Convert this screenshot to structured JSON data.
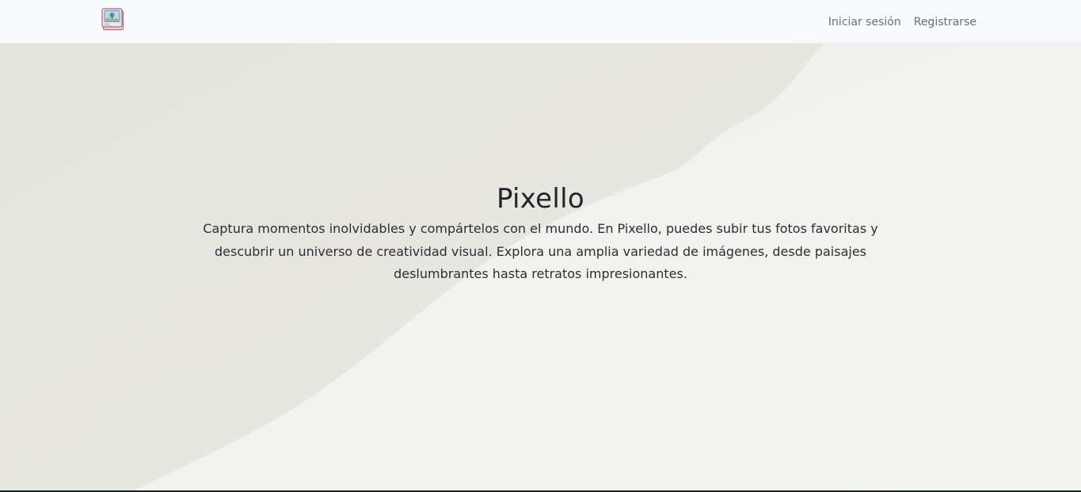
{
  "navbar": {
    "logo_icon": "photo-album-icon",
    "links": [
      {
        "label": "Iniciar sesión"
      },
      {
        "label": "Registrarse"
      }
    ]
  },
  "hero": {
    "title": "Pixello",
    "description": "Captura momentos inolvidables y compártelos con el mundo. En Pixello, puedes subir tus fotos favoritas y descubrir un universo de creatividad visual. Explora una amplia variedad de imágenes, desde paisajes deslumbrantes hasta retratos impresionantes."
  },
  "colors": {
    "navbar_bg": "#f8f9fa",
    "hero_bg_light": "#efefea",
    "hero_bg_dark": "#e2e3dc",
    "text": "#212529",
    "nav_link": "#6c6f73",
    "logo_pink": "#c98da3",
    "logo_blue": "#a9d4e6"
  }
}
